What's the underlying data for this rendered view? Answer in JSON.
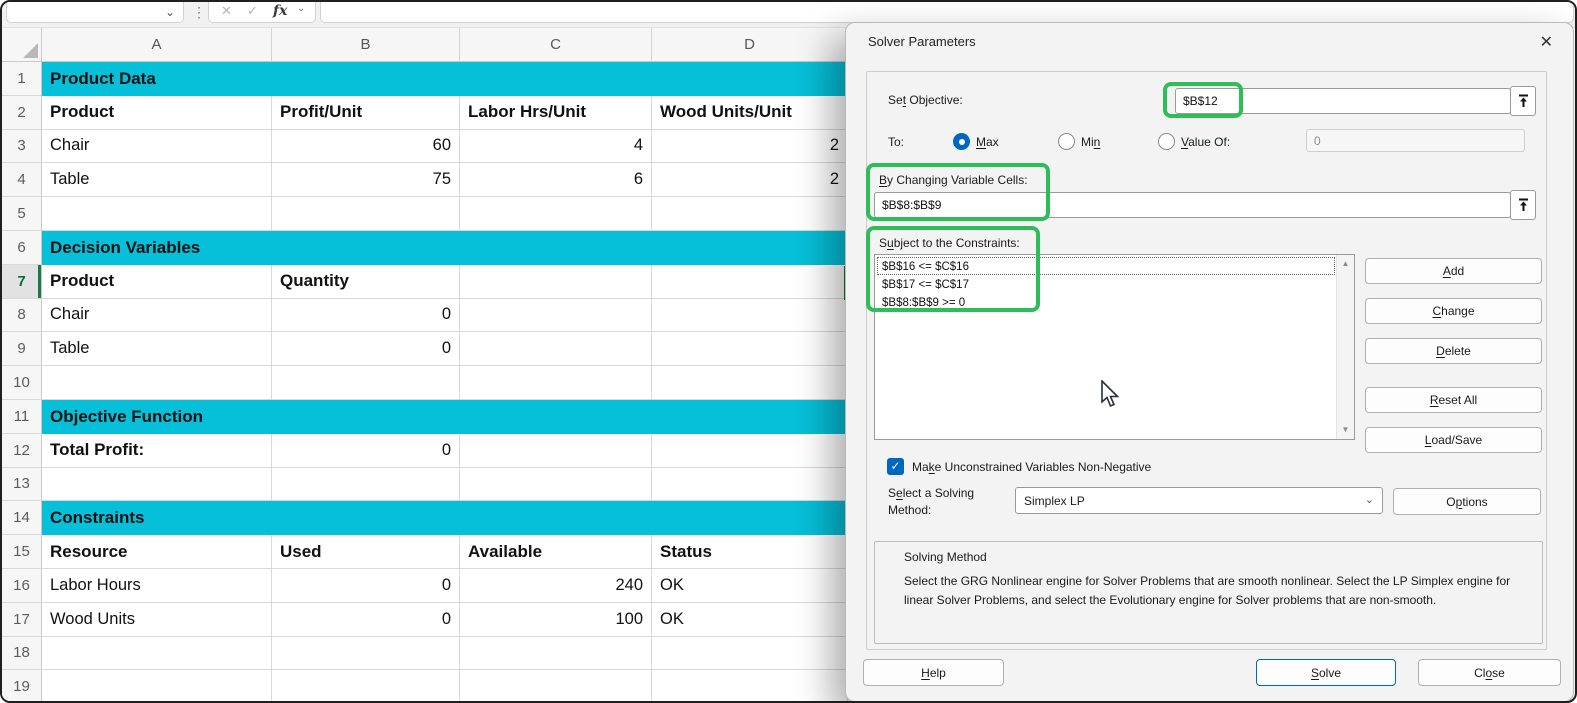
{
  "formula_bar": {
    "name_box_value": "",
    "cancel_icon": "✕",
    "enter_icon": "✓",
    "fx_label": "fx",
    "dots_icon": "⋮",
    "chevron_icon": "⌄"
  },
  "sheet": {
    "columns": [
      "A",
      "B",
      "C",
      "D"
    ],
    "active_row": 7,
    "rows": [
      {
        "n": "1",
        "section": "Product Data"
      },
      {
        "n": "2",
        "cells": [
          {
            "t": "Product",
            "b": 1
          },
          {
            "t": "Profit/Unit",
            "b": 1
          },
          {
            "t": "Labor Hrs/Unit",
            "b": 1
          },
          {
            "t": "Wood Units/Unit",
            "b": 1
          }
        ]
      },
      {
        "n": "3",
        "cells": [
          {
            "t": "Chair"
          },
          {
            "t": "60",
            "r": 1
          },
          {
            "t": "4",
            "r": 1
          },
          {
            "t": "2",
            "r": 1
          }
        ]
      },
      {
        "n": "4",
        "cells": [
          {
            "t": "Table"
          },
          {
            "t": "75",
            "r": 1
          },
          {
            "t": "6",
            "r": 1
          },
          {
            "t": "2",
            "r": 1
          }
        ]
      },
      {
        "n": "5",
        "cells": [
          {},
          {},
          {},
          {}
        ]
      },
      {
        "n": "6",
        "section": "Decision Variables"
      },
      {
        "n": "7",
        "active": 1,
        "cells": [
          {
            "t": "Product",
            "b": 1
          },
          {
            "t": "Quantity",
            "b": 1
          },
          {},
          {}
        ]
      },
      {
        "n": "8",
        "cells": [
          {
            "t": "Chair"
          },
          {
            "t": "0",
            "r": 1
          },
          {},
          {}
        ]
      },
      {
        "n": "9",
        "cells": [
          {
            "t": "Table"
          },
          {
            "t": "0",
            "r": 1
          },
          {},
          {}
        ]
      },
      {
        "n": "10",
        "cells": [
          {},
          {},
          {},
          {}
        ]
      },
      {
        "n": "11",
        "section": "Objective Function"
      },
      {
        "n": "12",
        "cells": [
          {
            "t": "Total Profit:",
            "b": 1
          },
          {
            "t": "0",
            "r": 1
          },
          {},
          {}
        ]
      },
      {
        "n": "13",
        "cells": [
          {},
          {},
          {},
          {}
        ]
      },
      {
        "n": "14",
        "section": "Constraints"
      },
      {
        "n": "15",
        "cells": [
          {
            "t": "Resource",
            "b": 1
          },
          {
            "t": "Used",
            "b": 1
          },
          {
            "t": "Available",
            "b": 1
          },
          {
            "t": "Status",
            "b": 1
          }
        ]
      },
      {
        "n": "16",
        "cells": [
          {
            "t": "Labor Hours"
          },
          {
            "t": "0",
            "r": 1
          },
          {
            "t": "240",
            "r": 1
          },
          {
            "t": "OK"
          }
        ]
      },
      {
        "n": "17",
        "cells": [
          {
            "t": "Wood Units"
          },
          {
            "t": "0",
            "r": 1
          },
          {
            "t": "100",
            "r": 1
          },
          {
            "t": "OK"
          }
        ]
      },
      {
        "n": "18",
        "cells": [
          {},
          {},
          {},
          {}
        ]
      },
      {
        "n": "19",
        "cells": [
          {},
          {},
          {},
          {}
        ]
      }
    ]
  },
  "dialog": {
    "title": "Solver Parameters",
    "close_icon": "✕",
    "set_objective_label": "Se|t| Objective:",
    "objective_value": "$B$12",
    "to_label": "To:",
    "radio_max": "|M|ax",
    "radio_min": "Mi|n|",
    "radio_value_of": "|V|alue Of:",
    "selected_radio": "max",
    "value_of_value": "0",
    "by_changing_label": "|B|y Changing Variable Cells:",
    "variable_cells_value": "$B$8:$B$9",
    "subject_label": "S|u|bject to the Constraints:",
    "constraints": [
      "$B$16 <= $C$16",
      "$B$17 <= $C$17",
      "$B$8:$B$9 >= 0"
    ],
    "selected_constraint": 0,
    "buttons": {
      "add": "|A|dd",
      "change": "|C|hange",
      "delete": "|D|elete",
      "reset_all": "|R|eset All",
      "load_save": "|L|oad/Save",
      "options": "O|p|tions",
      "help": "|H|elp",
      "solve": "|S|olve",
      "close": "Cl|o|se"
    },
    "non_negative_label": "Ma|k|e Unconstrained Variables Non-Negative",
    "non_negative_checked": true,
    "check_icon": "✓",
    "solving_method_label_line1": "S|e|lect a Solving",
    "solving_method_label_line2": "Method:",
    "solving_method_value": "Simplex LP",
    "scrollbar_up_icon": "▲",
    "scrollbar_down_icon": "▼",
    "solving_method_box": {
      "title": "Solving Method",
      "description": "Select the GRG Nonlinear engine for Solver Problems that are smooth nonlinear. Select the LP Simplex engine for linear Solver Problems, and select the Evolutionary engine for Solver problems that are non-smooth."
    }
  },
  "colors": {
    "accent_teal": "#06BFD8",
    "annotation_green": "#2EBD59",
    "selection_green": "#0E7C42",
    "radio_blue": "#0067C0"
  }
}
